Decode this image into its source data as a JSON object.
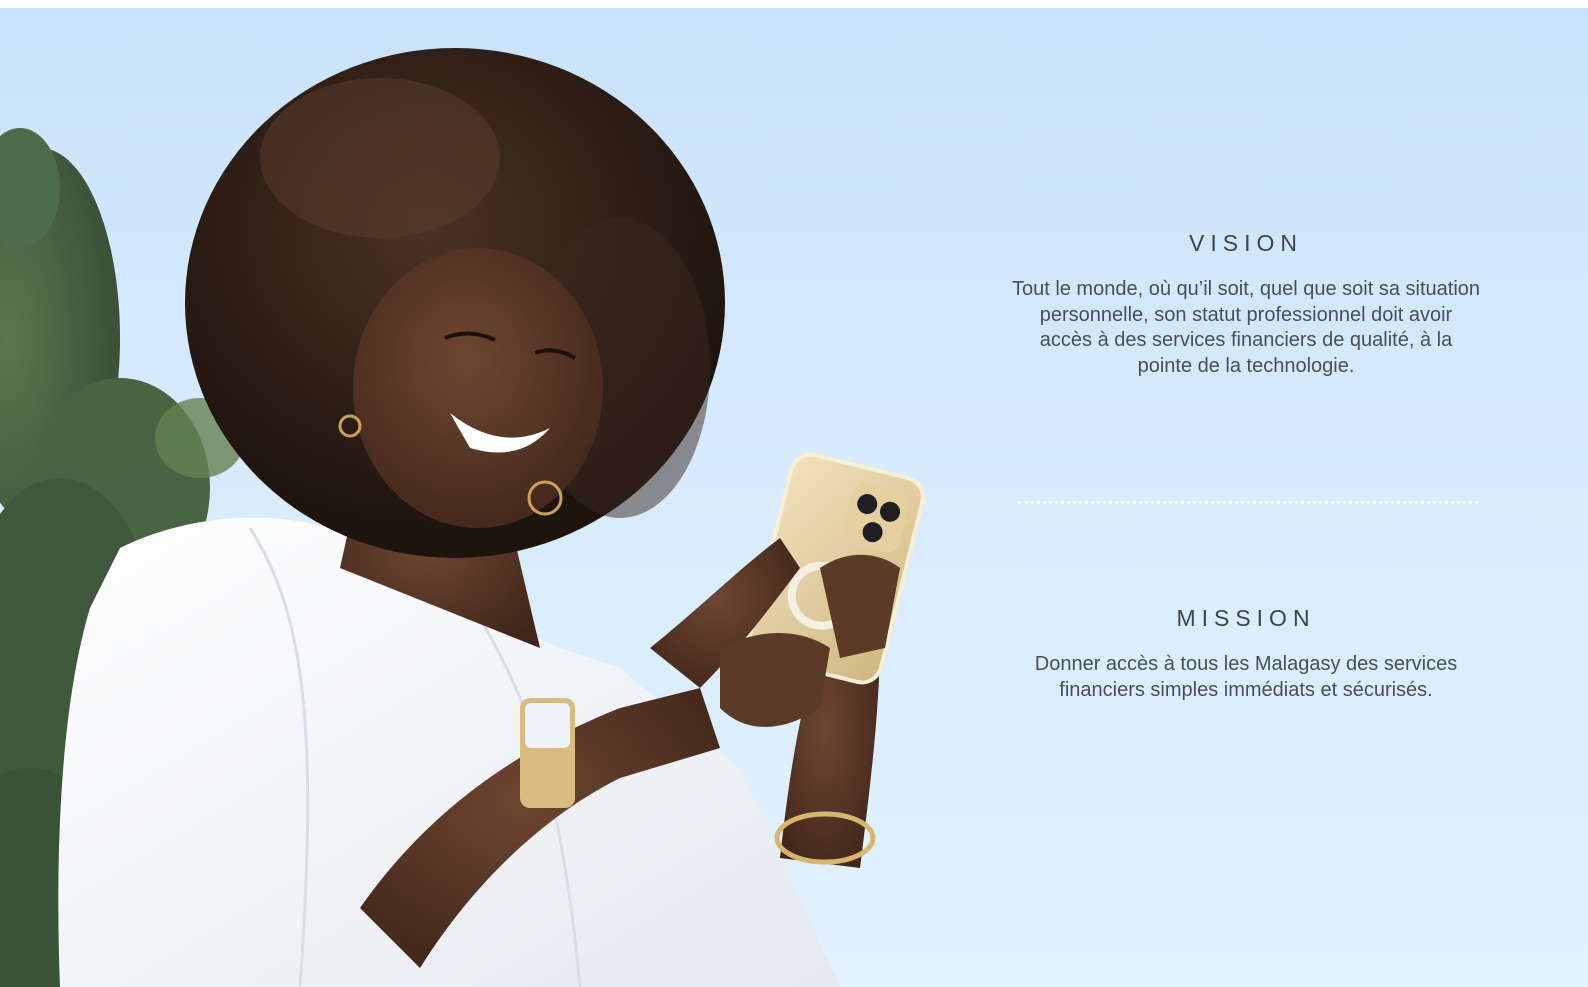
{
  "vision": {
    "heading": "VISION",
    "text": "Tout le monde, où qu’il soit, quel que soit sa situation personnelle, son statut professionnel doit avoir accès à des services financiers de qualité, à la pointe de la technologie."
  },
  "mission": {
    "heading": "MISSION",
    "text": "Donner accès à tous les Malagasy des services financiers simples immédiats et sécurisés."
  },
  "colors": {
    "sky": "#cfe6fc",
    "heading_text": "#3f434a",
    "body_text": "#4a4e55",
    "divider": "#ffffff"
  }
}
